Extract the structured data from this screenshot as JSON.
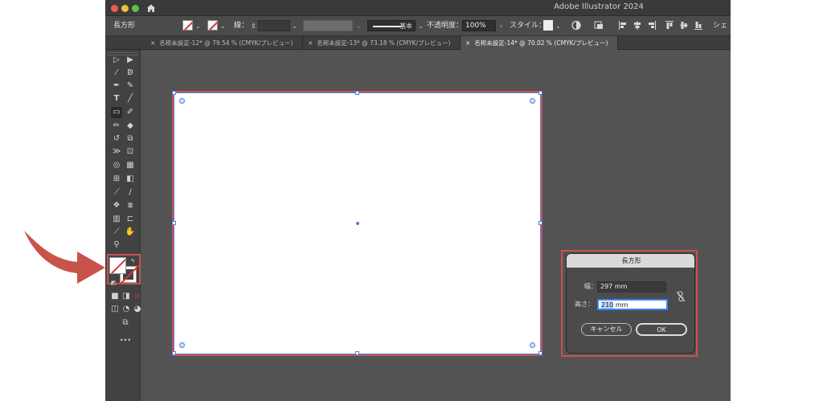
{
  "window": {
    "app_title": "Adobe Illustrator 2024"
  },
  "control_bar": {
    "tool_name": "長方形",
    "stroke_label": "線：",
    "stroke_profile_label": "基本",
    "opacity_label": "不透明度：",
    "opacity_value": "100%",
    "style_label": "スタイル：",
    "overflow_label": "シェ"
  },
  "tabs": [
    {
      "label": "名称未設定-12* @ 79.54 % (CMYK/プレビュー)",
      "active": false
    },
    {
      "label": "名称未設定-13* @ 73.18 % (CMYK/プレビュー)",
      "active": false
    },
    {
      "label": "名称未設定-14* @ 70.02 % (CMYK/プレビュー)",
      "active": true
    }
  ],
  "tools": {
    "more_label": "•••"
  },
  "dialog": {
    "title": "長方形",
    "width_label": "幅：",
    "width_value": "297 mm",
    "height_label": "高さ：",
    "height_selected": "210",
    "height_unit": " mm",
    "cancel_label": "キャンセル",
    "ok_label": "OK"
  },
  "colors": {
    "highlight": "#c8534a",
    "selection": "#4f7ee0",
    "ui_bg": "#535353"
  }
}
